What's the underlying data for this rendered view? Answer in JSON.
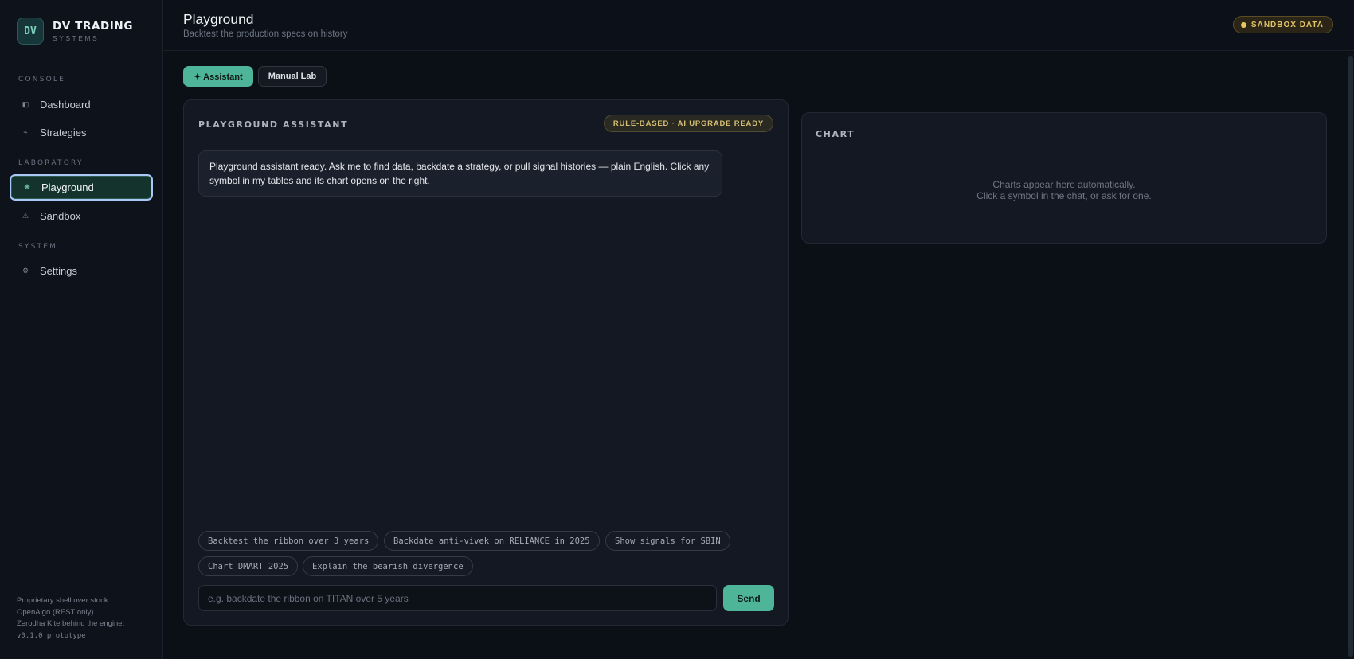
{
  "brand": {
    "logo": "DV",
    "name": "DV TRADING",
    "sub": "SYSTEMS"
  },
  "sidebar": {
    "sections": [
      {
        "label": "CONSOLE"
      },
      {
        "label": "LABORATORY"
      },
      {
        "label": "SYSTEM"
      }
    ],
    "items": [
      {
        "label": "Dashboard",
        "icon": "◧",
        "icon_name": "dashboard-icon"
      },
      {
        "label": "Strategies",
        "icon": "⌁",
        "icon_name": "strategies-icon"
      },
      {
        "label": "Playground",
        "icon": "❋",
        "icon_name": "playground-icon",
        "active": true
      },
      {
        "label": "Sandbox",
        "icon": "⚠",
        "icon_name": "sandbox-icon"
      },
      {
        "label": "Settings",
        "icon": "⚙",
        "icon_name": "settings-icon"
      }
    ],
    "footer": {
      "line1": "Proprietary shell over stock",
      "line2": "OpenAlgo (REST only).",
      "line3": "Zerodha Kite behind the engine.",
      "version": "v0.1.0 prototype"
    }
  },
  "header": {
    "title": "Playground",
    "subtitle": "Backtest the production specs on history",
    "badge": "SANDBOX DATA"
  },
  "tabs": [
    {
      "label": "✦ Assistant",
      "active": true
    },
    {
      "label": "Manual Lab",
      "active": false
    }
  ],
  "assistant": {
    "title": "PLAYGROUND ASSISTANT",
    "badge": "RULE-BASED · AI UPGRADE READY",
    "message": "Playground assistant ready. Ask me to find data, backdate a strategy, or pull signal histories — plain English. Click any symbol in my tables and its chart opens on the right.",
    "chips": [
      "Backtest the ribbon over 3 years",
      "Backdate anti-vivek on RELIANCE in 2025",
      "Show signals for SBIN",
      "Chart DMART 2025",
      "Explain the bearish divergence"
    ],
    "input_placeholder": "e.g. backdate the ribbon on TITAN over 5 years",
    "input_value": "",
    "send_label": "Send"
  },
  "chart": {
    "title": "CHART",
    "empty_line1": "Charts appear here automatically.",
    "empty_line2": "Click a symbol in the chat, or ask for one."
  },
  "colors": {
    "accent": "#4fb598",
    "warning": "#e2c46a",
    "active_outline": "#a8c8f6"
  }
}
